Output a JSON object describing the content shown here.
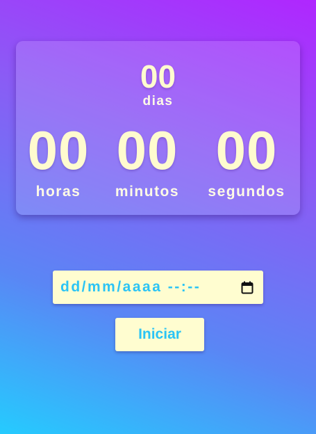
{
  "countdown": {
    "days": {
      "value": "00",
      "label": "dias"
    },
    "hours": {
      "value": "00",
      "label": "horas"
    },
    "minutes": {
      "value": "00",
      "label": "minutos"
    },
    "seconds": {
      "value": "00",
      "label": "segundos"
    }
  },
  "datetime_input": {
    "placeholder": "dd/mm/aaaa --:--",
    "icon": "calendar-icon"
  },
  "start_button": {
    "label": "Iniciar"
  },
  "colors": {
    "gradient_top": "#b026ff",
    "gradient_bottom": "#25cbfe",
    "number_color": "#fffbcf",
    "accent_text": "#2bc4f5",
    "control_bg": "#fffdd0"
  }
}
